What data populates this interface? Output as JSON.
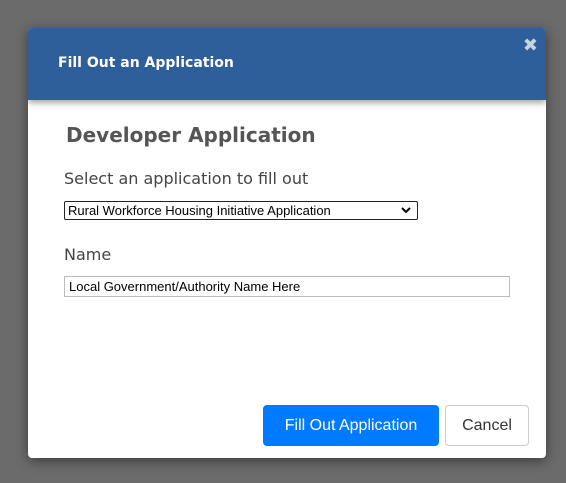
{
  "modal": {
    "title": "Fill Out an Application",
    "close_icon": "close-icon",
    "close_glyph": "✖",
    "heading": "Developer Application",
    "select_label": "Select an application to fill out",
    "select_value": "Rural Workforce Housing Initiative Application",
    "name_label": "Name",
    "name_value": "Local Government/Authority Name Here",
    "primary_button": "Fill Out Application",
    "cancel_button": "Cancel"
  },
  "colors": {
    "overlay": "#6b6b6b",
    "header": "#2e5f9a",
    "primary": "#007bff"
  }
}
